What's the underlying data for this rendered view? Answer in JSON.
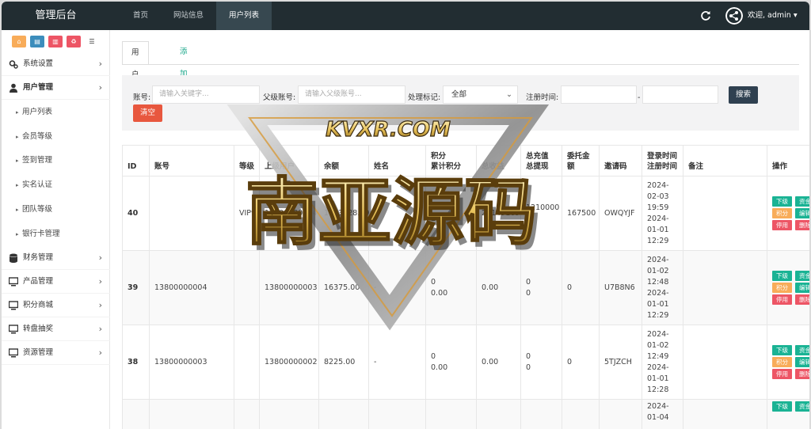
{
  "topbar": {
    "brand": "管理后台",
    "nav": [
      "首页",
      "网站信息",
      "用户列表"
    ],
    "user": "欢迎, admin ▾"
  },
  "sidebar": {
    "menu": [
      {
        "label": "系统设置",
        "icon": "gears-icon"
      },
      {
        "label": "用户管理",
        "icon": "user-icon"
      },
      {
        "label": "财务管理",
        "icon": "database-icon"
      },
      {
        "label": "产品管理",
        "icon": "monitor-icon"
      },
      {
        "label": "积分商城",
        "icon": "monitor-icon"
      },
      {
        "label": "转盘抽奖",
        "icon": "monitor-icon"
      },
      {
        "label": "资源管理",
        "icon": "monitor-icon"
      }
    ],
    "sub": [
      "用户列表",
      "会员等级",
      "签到管理",
      "实名认证",
      "团队等级",
      "银行卡管理"
    ]
  },
  "tabs": [
    "用户列表",
    "添加用户"
  ],
  "search": {
    "account_label": "账号:",
    "account_placeholder": "请输入关键字...",
    "parent_label": "父级账号:",
    "parent_placeholder": "请输入父级账号...",
    "mark_label": "处理标记:",
    "mark_value": "全部",
    "reg_label": "注册时间:",
    "dash": "-",
    "search_btn": "搜索",
    "clear_btn": "清空"
  },
  "table": {
    "headers": [
      "ID",
      "账号",
      "等级",
      "上级用户",
      "余额",
      "姓名",
      "积分\n累计积分",
      "总收益",
      "总充值\n总提现",
      "委托金\n额",
      "邀请码",
      "登录时间\n注册时间",
      "备注",
      "操作"
    ],
    "ops": [
      "下级",
      "资金",
      "积分",
      "编辑",
      "停用",
      "删除"
    ],
    "rows": [
      {
        "id": "40",
        "account": "",
        "level": "VIP9",
        "parent": "13800000004",
        "balance": "1473828.59",
        "name": "",
        "points": "277400\n277500.00",
        "income": "27149169",
        "recharge": "1210000\n0",
        "entrust": "167500",
        "code": "OWQYJF",
        "times": "2024-\n02-03\n19:59\n2024-\n01-01\n12:29",
        "note": ""
      },
      {
        "id": "39",
        "account": "13800000004",
        "level": "",
        "parent": "13800000003",
        "balance": "16375.00",
        "name": "-",
        "points": "0\n0.00",
        "income": "0.00",
        "recharge": "0\n0",
        "entrust": "0",
        "code": "U7B8N6",
        "times": "2024-\n01-02\n12:48\n2024-\n01-01\n12:29",
        "note": ""
      },
      {
        "id": "38",
        "account": "13800000003",
        "level": "",
        "parent": "13800000002",
        "balance": "8225.00",
        "name": "-",
        "points": "0\n0.00",
        "income": "0.00",
        "recharge": "0\n0",
        "entrust": "0",
        "code": "5TJZCH",
        "times": "2024-\n01-02\n12:49\n2024-\n01-01\n12:28",
        "note": ""
      },
      {
        "id": "",
        "account": "",
        "level": "",
        "parent": "",
        "balance": "",
        "name": "",
        "points": "",
        "income": "",
        "recharge": "",
        "entrust": "",
        "code": "",
        "times": "2024-\n01-04",
        "note": ""
      }
    ]
  },
  "watermark": {
    "top": "KVXR.COM",
    "main": "南亚源码"
  }
}
